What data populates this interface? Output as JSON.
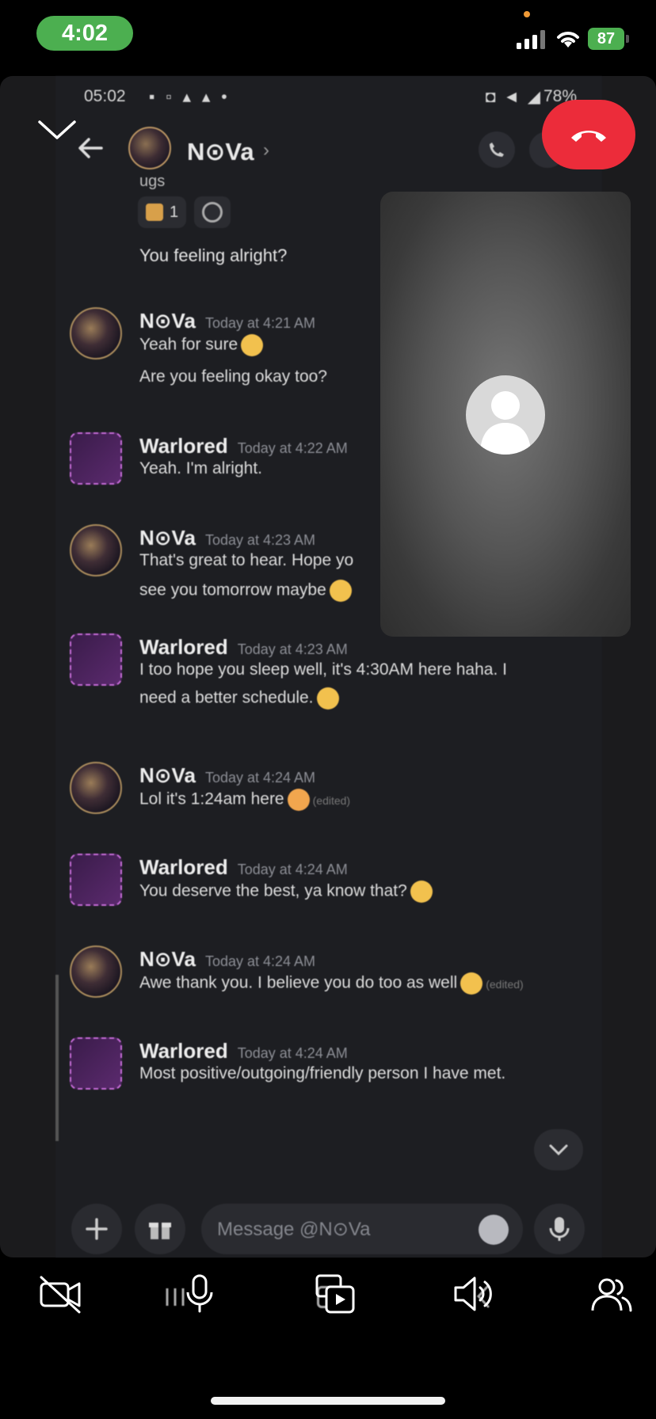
{
  "ios_status": {
    "time": "4:02",
    "battery": "87"
  },
  "android_status": {
    "time": "05:02",
    "battery": "78%"
  },
  "chat_header": {
    "name": "N⊙Va",
    "chevron": "›"
  },
  "messages_top": {
    "truncated": "ugs",
    "reaction_count": "1",
    "standalone": "You feeling alright?"
  },
  "messages": [
    {
      "author": "N⊙Va",
      "time": "Today at 4:21 AM",
      "lines": [
        "Yeah for sure",
        "Are you feeling okay too?"
      ]
    },
    {
      "author": "Warlored",
      "time": "Today at 4:22 AM",
      "lines": [
        "Yeah. I'm alright."
      ]
    },
    {
      "author": "N⊙Va",
      "time": "Today at 4:23 AM",
      "lines": [
        "That's great to hear. Hope yo",
        "see you tomorrow maybe"
      ]
    },
    {
      "author": "Warlored",
      "time": "Today at 4:23 AM",
      "lines": [
        "I too hope you sleep well, it's 4:30AM here haha. I",
        "need a better schedule."
      ]
    },
    {
      "author": "N⊙Va",
      "time": "Today at 4:24 AM",
      "lines": [
        "Lol it's 1:24am here"
      ],
      "edited": "(edited)"
    },
    {
      "author": "Warlored",
      "time": "Today at 4:24 AM",
      "lines": [
        "You deserve the best, ya know that?"
      ]
    },
    {
      "author": "N⊙Va",
      "time": "Today at 4:24 AM",
      "lines": [
        "Awe thank you. I believe you do too as well"
      ],
      "edited": "(edited)"
    },
    {
      "author": "Warlored",
      "time": "Today at 4:24 AM",
      "lines": [
        "Most positive/outgoing/friendly person I have met."
      ]
    }
  ],
  "composer": {
    "placeholder": "Message @N⊙Va"
  },
  "colors": {
    "end_call": "#ec2c3a",
    "ios_green": "#4caf50",
    "app_bg": "#1d1e22"
  }
}
